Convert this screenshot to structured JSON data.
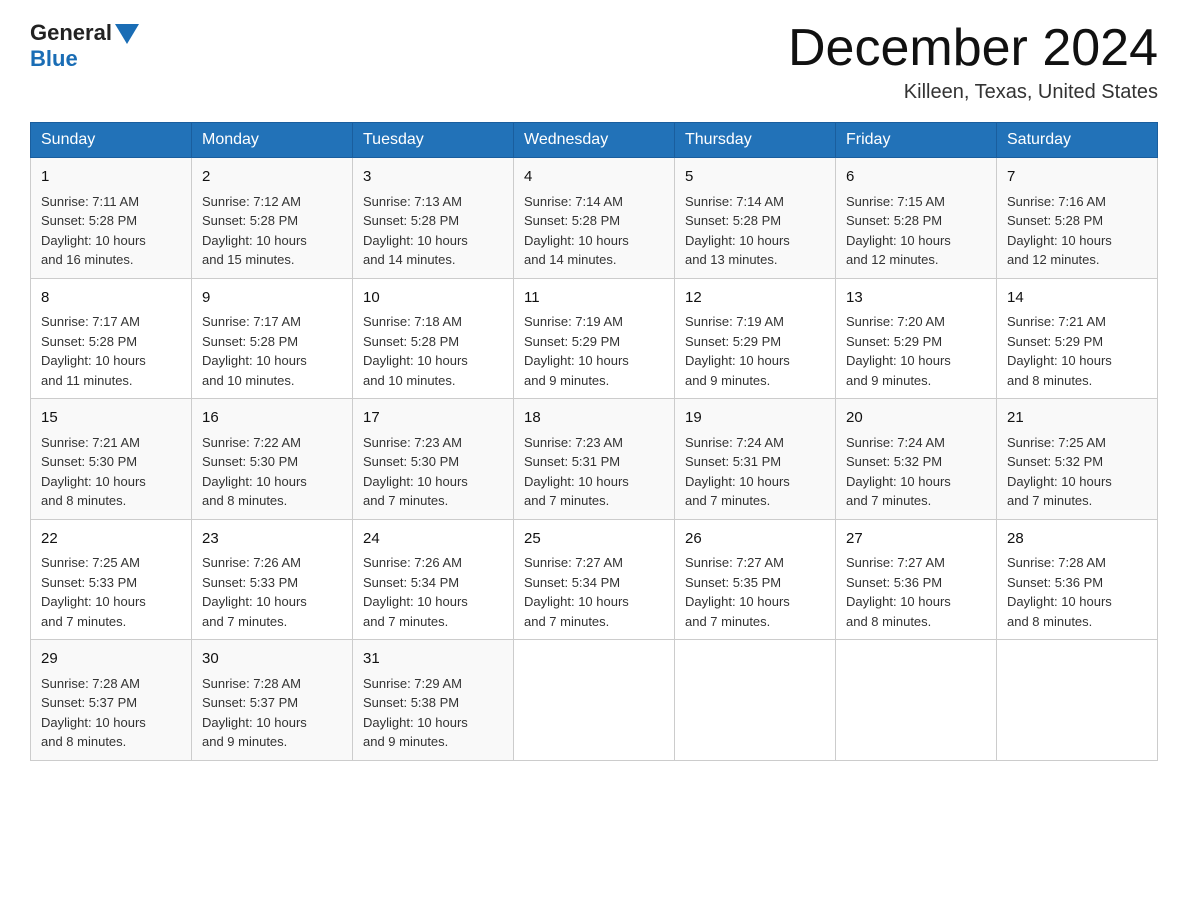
{
  "logo": {
    "general": "General",
    "blue": "Blue"
  },
  "title": {
    "month_year": "December 2024",
    "location": "Killeen, Texas, United States"
  },
  "days_of_week": [
    "Sunday",
    "Monday",
    "Tuesday",
    "Wednesday",
    "Thursday",
    "Friday",
    "Saturday"
  ],
  "weeks": [
    [
      {
        "day": "1",
        "sunrise": "7:11 AM",
        "sunset": "5:28 PM",
        "daylight": "10 hours and 16 minutes."
      },
      {
        "day": "2",
        "sunrise": "7:12 AM",
        "sunset": "5:28 PM",
        "daylight": "10 hours and 15 minutes."
      },
      {
        "day": "3",
        "sunrise": "7:13 AM",
        "sunset": "5:28 PM",
        "daylight": "10 hours and 14 minutes."
      },
      {
        "day": "4",
        "sunrise": "7:14 AM",
        "sunset": "5:28 PM",
        "daylight": "10 hours and 14 minutes."
      },
      {
        "day": "5",
        "sunrise": "7:14 AM",
        "sunset": "5:28 PM",
        "daylight": "10 hours and 13 minutes."
      },
      {
        "day": "6",
        "sunrise": "7:15 AM",
        "sunset": "5:28 PM",
        "daylight": "10 hours and 12 minutes."
      },
      {
        "day": "7",
        "sunrise": "7:16 AM",
        "sunset": "5:28 PM",
        "daylight": "10 hours and 12 minutes."
      }
    ],
    [
      {
        "day": "8",
        "sunrise": "7:17 AM",
        "sunset": "5:28 PM",
        "daylight": "10 hours and 11 minutes."
      },
      {
        "day": "9",
        "sunrise": "7:17 AM",
        "sunset": "5:28 PM",
        "daylight": "10 hours and 10 minutes."
      },
      {
        "day": "10",
        "sunrise": "7:18 AM",
        "sunset": "5:28 PM",
        "daylight": "10 hours and 10 minutes."
      },
      {
        "day": "11",
        "sunrise": "7:19 AM",
        "sunset": "5:29 PM",
        "daylight": "10 hours and 9 minutes."
      },
      {
        "day": "12",
        "sunrise": "7:19 AM",
        "sunset": "5:29 PM",
        "daylight": "10 hours and 9 minutes."
      },
      {
        "day": "13",
        "sunrise": "7:20 AM",
        "sunset": "5:29 PM",
        "daylight": "10 hours and 9 minutes."
      },
      {
        "day": "14",
        "sunrise": "7:21 AM",
        "sunset": "5:29 PM",
        "daylight": "10 hours and 8 minutes."
      }
    ],
    [
      {
        "day": "15",
        "sunrise": "7:21 AM",
        "sunset": "5:30 PM",
        "daylight": "10 hours and 8 minutes."
      },
      {
        "day": "16",
        "sunrise": "7:22 AM",
        "sunset": "5:30 PM",
        "daylight": "10 hours and 8 minutes."
      },
      {
        "day": "17",
        "sunrise": "7:23 AM",
        "sunset": "5:30 PM",
        "daylight": "10 hours and 7 minutes."
      },
      {
        "day": "18",
        "sunrise": "7:23 AM",
        "sunset": "5:31 PM",
        "daylight": "10 hours and 7 minutes."
      },
      {
        "day": "19",
        "sunrise": "7:24 AM",
        "sunset": "5:31 PM",
        "daylight": "10 hours and 7 minutes."
      },
      {
        "day": "20",
        "sunrise": "7:24 AM",
        "sunset": "5:32 PM",
        "daylight": "10 hours and 7 minutes."
      },
      {
        "day": "21",
        "sunrise": "7:25 AM",
        "sunset": "5:32 PM",
        "daylight": "10 hours and 7 minutes."
      }
    ],
    [
      {
        "day": "22",
        "sunrise": "7:25 AM",
        "sunset": "5:33 PM",
        "daylight": "10 hours and 7 minutes."
      },
      {
        "day": "23",
        "sunrise": "7:26 AM",
        "sunset": "5:33 PM",
        "daylight": "10 hours and 7 minutes."
      },
      {
        "day": "24",
        "sunrise": "7:26 AM",
        "sunset": "5:34 PM",
        "daylight": "10 hours and 7 minutes."
      },
      {
        "day": "25",
        "sunrise": "7:27 AM",
        "sunset": "5:34 PM",
        "daylight": "10 hours and 7 minutes."
      },
      {
        "day": "26",
        "sunrise": "7:27 AM",
        "sunset": "5:35 PM",
        "daylight": "10 hours and 7 minutes."
      },
      {
        "day": "27",
        "sunrise": "7:27 AM",
        "sunset": "5:36 PM",
        "daylight": "10 hours and 8 minutes."
      },
      {
        "day": "28",
        "sunrise": "7:28 AM",
        "sunset": "5:36 PM",
        "daylight": "10 hours and 8 minutes."
      }
    ],
    [
      {
        "day": "29",
        "sunrise": "7:28 AM",
        "sunset": "5:37 PM",
        "daylight": "10 hours and 8 minutes."
      },
      {
        "day": "30",
        "sunrise": "7:28 AM",
        "sunset": "5:37 PM",
        "daylight": "10 hours and 9 minutes."
      },
      {
        "day": "31",
        "sunrise": "7:29 AM",
        "sunset": "5:38 PM",
        "daylight": "10 hours and 9 minutes."
      },
      null,
      null,
      null,
      null
    ]
  ],
  "labels": {
    "sunrise": "Sunrise:",
    "sunset": "Sunset:",
    "daylight": "Daylight:"
  }
}
